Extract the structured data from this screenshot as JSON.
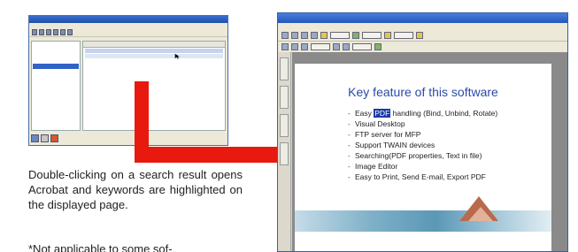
{
  "search_window": {
    "title": "",
    "tree_items": [
      "",
      "",
      "",
      "",
      ""
    ],
    "results_header": ""
  },
  "caption": {
    "text": "Double-clicking on a search result opens Acrobat and keywords are highlighted on the displayed page.",
    "note": "*Not applicable to some sof-"
  },
  "acrobat_window": {
    "title": "",
    "menu": ""
  },
  "slide": {
    "title": "Key feature of this software",
    "items": [
      {
        "before": "Easy ",
        "highlight": "PDF",
        "after": " handling (Bind, Unbind, Rotate)"
      },
      {
        "before": "Visual Desktop",
        "highlight": "",
        "after": ""
      },
      {
        "before": "FTP server for MFP",
        "highlight": "",
        "after": ""
      },
      {
        "before": "Support TWAIN devices",
        "highlight": "",
        "after": ""
      },
      {
        "before": "Searching(PDF properties, Text in file)",
        "highlight": "",
        "after": ""
      },
      {
        "before": "Image Editor",
        "highlight": "",
        "after": ""
      },
      {
        "before": "Easy to Print, Send E-mail, Export PDF",
        "highlight": "",
        "after": ""
      }
    ]
  },
  "colors": {
    "arrow": "#e8190f",
    "slide_title": "#2b4aa8",
    "highlight": "#1b3aa6"
  },
  "icons": [
    "mouse-cursor-icon",
    "arrow-icon"
  ]
}
